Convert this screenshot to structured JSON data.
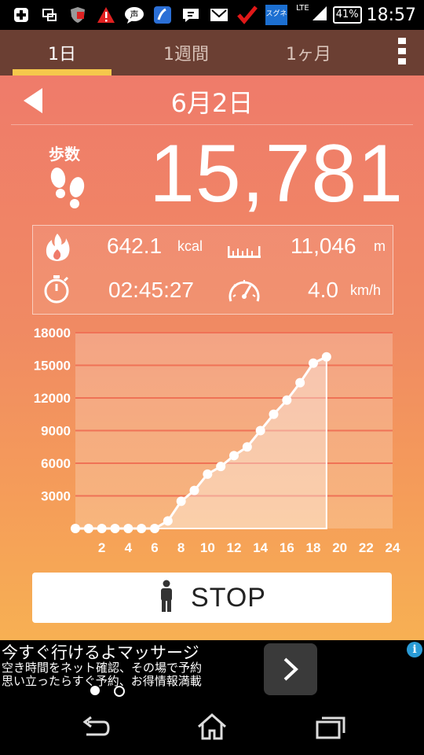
{
  "status_bar": {
    "network": "LTE",
    "battery": "41%",
    "time": "18:57",
    "icons": [
      "add-icon",
      "screen-icon",
      "shield-icon",
      "warning-icon",
      "chat-icon",
      "app-icon",
      "keyboard-icon",
      "mail-icon",
      "check-icon",
      "sugune-icon",
      "signal-icon"
    ],
    "sugune_label": "スグネ"
  },
  "tabs": [
    {
      "label": "1日",
      "active": true
    },
    {
      "label": "1週間",
      "active": false
    },
    {
      "label": "1ヶ月",
      "active": false
    }
  ],
  "date": "6月2日",
  "steps": {
    "label": "歩数",
    "value": "15,781"
  },
  "stats": {
    "calories": {
      "value": "642.1",
      "unit": "kcal",
      "icon": "flame-icon"
    },
    "distance": {
      "value": "11,046",
      "unit": "m",
      "icon": "ruler-icon"
    },
    "time": {
      "value": "02:45:27",
      "icon": "stopwatch-icon"
    },
    "speed": {
      "value": "4.0",
      "unit": "km/h",
      "icon": "speedometer-icon"
    }
  },
  "chart_data": {
    "type": "line",
    "title": "",
    "xlabel": "",
    "ylabel": "",
    "x": [
      0,
      1,
      2,
      3,
      4,
      5,
      6,
      7,
      8,
      9,
      10,
      11,
      12,
      13,
      14,
      15,
      16,
      17,
      18,
      19
    ],
    "values": [
      0,
      0,
      0,
      0,
      0,
      0,
      0,
      700,
      2500,
      3500,
      5000,
      5700,
      6700,
      7500,
      9000,
      10500,
      11800,
      13400,
      15200,
      15781
    ],
    "xlim": [
      0,
      24
    ],
    "ylim": [
      0,
      18000
    ],
    "yticks": [
      "3000",
      "6000",
      "9000",
      "12000",
      "15000",
      "18000"
    ],
    "xticks": [
      "2",
      "4",
      "6",
      "8",
      "10",
      "12",
      "14",
      "16",
      "18",
      "20",
      "22",
      "24"
    ],
    "grid": true
  },
  "stop_button": {
    "label": "STOP",
    "icon": "person-icon"
  },
  "ad": {
    "title": "今すぐ行けるよマッサージ",
    "line1": "空き時間をネット確認、その場で予約",
    "line2": "思い立ったらすぐ予約、お得情報満載",
    "arrow_icon": "chevron-right-icon",
    "info_icon": "info-icon",
    "info_glyph": "i"
  },
  "nav": {
    "icons": [
      "back-icon",
      "home-icon",
      "recents-icon"
    ]
  },
  "colors": {
    "tabbar": "#6b3f33",
    "accent": "#f5c84c",
    "gradient_top": "#ef7b6a",
    "gradient_bottom": "#f7b053"
  }
}
